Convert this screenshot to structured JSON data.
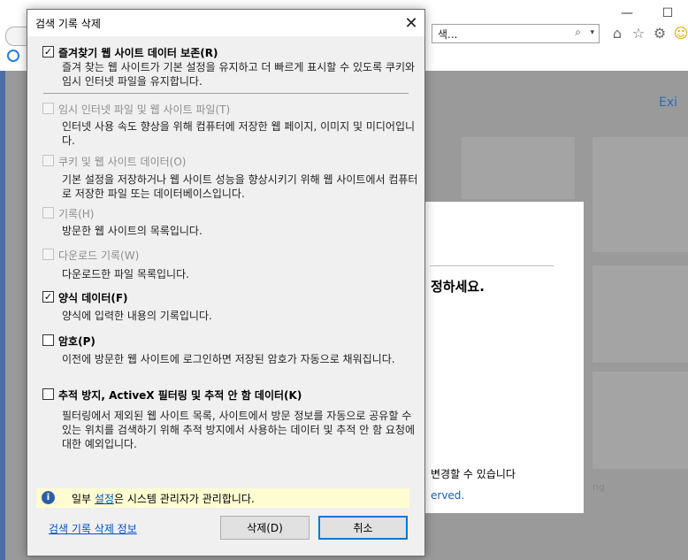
{
  "browser": {
    "window_controls": [
      "—",
      "☐"
    ],
    "address_text": "색...",
    "address_search_glyph": "⌕",
    "address_dropdown_glyph": "▾",
    "toolbar_icons": [
      "home-icon",
      "favorites-star-icon",
      "settings-gear-icon",
      "smiley-feedback-icon"
    ],
    "page_link": "Exi",
    "panel_heading": "정하세요.",
    "panel_note": "변경할 수 있습니다",
    "panel_reserved": "erved.",
    "faint_text": "ng"
  },
  "dialog": {
    "title": "검색 기록 삭제",
    "close_glyph": "✕",
    "options": [
      {
        "label": "즐겨찾기 웹 사이트 데이터 보존(R)",
        "checked": true,
        "enabled": true,
        "bold": true,
        "description": "즐겨 찾는 웹 사이트가 기본 설정을 유지하고 더 빠르게 표시할 수 있도록 쿠키와 임시 인터넷 파일을 유지합니다."
      },
      {
        "label": "임시 인터넷 파일 및 웹 사이트 파일(T)",
        "checked": false,
        "enabled": false,
        "bold": false,
        "description": "인터넷 사용 속도 향상을 위해 컴퓨터에 저장한 웹 페이지, 이미지 및 미디어입니다."
      },
      {
        "label": "쿠키 및 웹 사이트 데이터(O)",
        "checked": false,
        "enabled": false,
        "bold": false,
        "description": "기본 설정을 저장하거나 웹 사이트 성능을 향상시키기 위해 웹 사이트에서 컴퓨터로 저장한 파일 또는 데이터베이스입니다."
      },
      {
        "label": "기록(H)",
        "checked": false,
        "enabled": false,
        "bold": false,
        "description": "방문한 웹 사이트의 목록입니다."
      },
      {
        "label": "다운로드 기록(W)",
        "checked": false,
        "enabled": false,
        "bold": false,
        "description": "다운로드한 파일 목록입니다."
      },
      {
        "label": "양식 데이터(F)",
        "checked": true,
        "enabled": true,
        "bold": true,
        "description": "양식에 입력한 내용의 기록입니다."
      },
      {
        "label": "암호(P)",
        "checked": false,
        "enabled": true,
        "bold": true,
        "description": "이전에 방문한 웹 사이트에 로그인하면 저장된 암호가 자동으로 채워집니다."
      },
      {
        "label": "추적 방지, ActiveX 필터링 및 추적 안 함 데이터(K)",
        "checked": false,
        "enabled": true,
        "bold": true,
        "description": "필터링에서 제외된 웹 사이트 목록, 사이트에서 방문 정보를 자동으로 공유할 수 있는 위치를 검색하기 위해 추적 방지에서 사용하는 데이터 및 추적 안 함 요청에 대한 예외입니다."
      }
    ],
    "check_glyph": "✓",
    "info": {
      "icon_glyph": "i",
      "prefix": "일부 ",
      "link": "설정",
      "suffix": "은 시스템 관리자가 관리합니다."
    },
    "about_link": "검색 기록 삭제 정보",
    "delete_button": "삭제(D)",
    "cancel_button": "취소"
  }
}
